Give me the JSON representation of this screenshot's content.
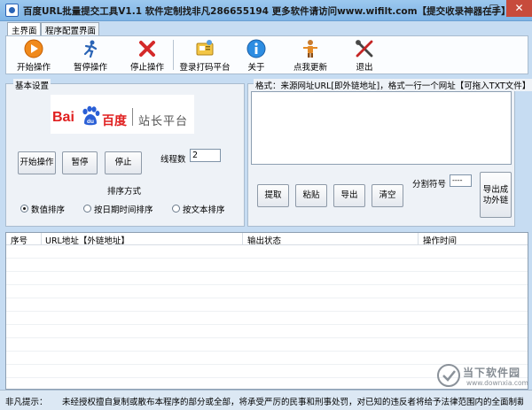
{
  "window": {
    "title": "百度URL批量提交工具V1.1 软件定制找非凡286655194 更多软件请访问www.wifilt.com【提交收录神器在手】",
    "min_label": "–",
    "max_label": "□",
    "close_label": "✕"
  },
  "tabs": [
    {
      "label": "主界面",
      "active": true
    },
    {
      "label": "程序配置界面",
      "active": false
    }
  ],
  "toolbar": {
    "items": [
      {
        "label": "开始操作",
        "icon": "play-icon"
      },
      {
        "label": "暂停操作",
        "icon": "running-man-icon"
      },
      {
        "label": "停止操作",
        "icon": "red-x-icon"
      },
      {
        "label": "登录打码平台",
        "icon": "captcha-card-icon"
      },
      {
        "label": "关于",
        "icon": "info-icon"
      },
      {
        "label": "点我更新",
        "icon": "update-figure-icon"
      },
      {
        "label": "退出",
        "icon": "tools-cross-icon"
      }
    ]
  },
  "basic": {
    "group_title": "基本设置",
    "logo": {
      "latin": "Bai",
      "du": "du",
      "cn": "百度",
      "platform": "站长平台"
    },
    "start_label": "开始操作",
    "pause_label": "暂停",
    "stop_label": "停止",
    "threads_label": "线程数",
    "threads_value": "2",
    "sort_title": "排序方式",
    "sort_options": [
      {
        "label": "数值排序",
        "selected": true
      },
      {
        "label": "按日期时间排序",
        "selected": false
      },
      {
        "label": "按文本排序",
        "selected": false
      }
    ]
  },
  "urls": {
    "group_title": "格式：来源网址URL[即外链地址]，格式一行一个网址【可拖入TXT文件】",
    "extract_label": "提取",
    "paste_label": "粘贴",
    "export_label": "导出",
    "clear_label": "清空",
    "separator_label": "分割符号",
    "separator_value": "----",
    "export_success_label": "导出成功外链"
  },
  "table": {
    "columns": [
      "序号",
      "URL地址【外链地址】",
      "输出状态",
      "操作时间"
    ]
  },
  "status": {
    "label": "非凡提示：",
    "text": "未经授权擅自复制或散布本程序的部分或全部，将承受严厉的民事和刑事处罚，对已知的违反者将给予法律范围内的全面制裁。"
  },
  "watermark": {
    "text": "当下软件园",
    "url": "www.downxia.com"
  },
  "colors": {
    "accent": "#2a64b6",
    "baidu_red": "#e02020",
    "close_red": "#c74b3c"
  }
}
